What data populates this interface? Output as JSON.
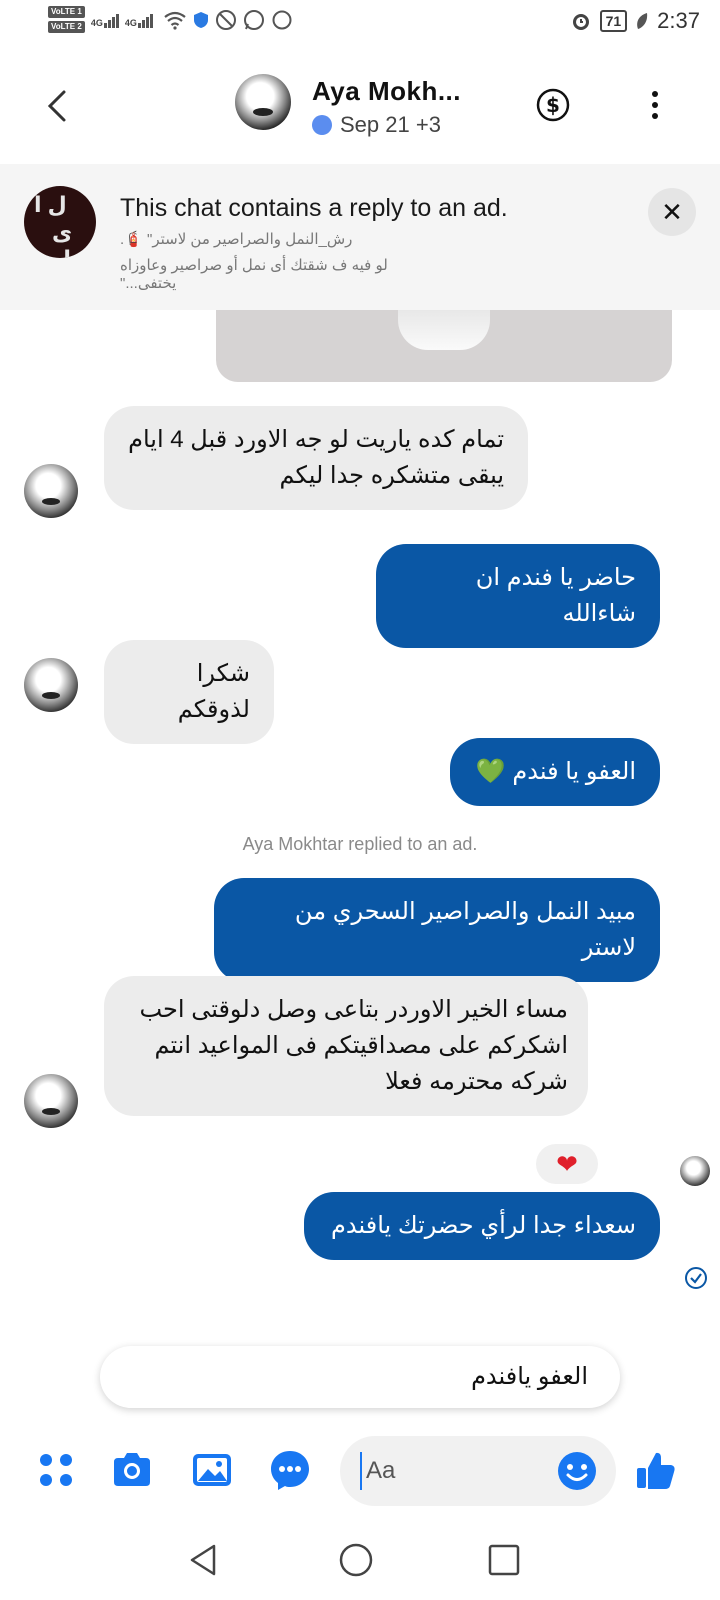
{
  "status_bar": {
    "volte1": "VoLTE 1",
    "volte2": "VoLTE 2",
    "net1": "4G",
    "net2": "4G",
    "battery": "71",
    "time": "2:37"
  },
  "header": {
    "name": "Aya Mokh...",
    "subtitle": "Sep 21 +3"
  },
  "ad_banner": {
    "title": "This chat contains a reply to an ad.",
    "line1": "رش_النمل والصراصير من لاستر\" 🧯.",
    "line2": "لو فيه ف شقتك أى نمل أو صراصير وعاوزاه يختفى...\""
  },
  "messages": [
    {
      "dir": "in",
      "text": "تمام  كده ياريت لو جه الاورد قبل 4 ايام يبقى متشكره جدا ليكم"
    },
    {
      "dir": "out",
      "text": "حاضر يا فندم ان شاءالله"
    },
    {
      "dir": "in",
      "text": "شكرا لذوقكم"
    },
    {
      "dir": "out",
      "text": "العفو يا فندم 💚"
    },
    {
      "dir": "out",
      "text": "مبيد النمل والصراصير السحري من لاستر"
    },
    {
      "dir": "in",
      "text": "مساء الخير الاوردر بتاعى وصل دلوقتى احب اشكركم على مصداقيتكم فى المواعيد انتم شركه محترمه فعلا"
    },
    {
      "dir": "out",
      "text": "سعداء جدا لرأي حضرتك يافندم"
    }
  ],
  "system_note": "Aya Mokhtar replied to an ad.",
  "reaction": "❤",
  "quick_reply": "العفو يافندم",
  "composer": {
    "placeholder": "Aa"
  },
  "colors": {
    "outgoing_bubble": "#0a57a5",
    "incoming_bubble": "#ececec",
    "accent": "#1877f2"
  }
}
